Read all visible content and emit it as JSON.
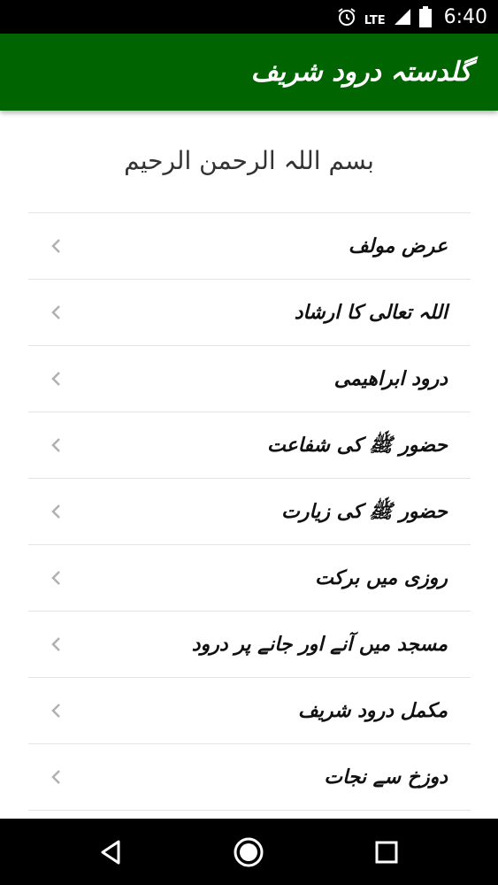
{
  "status_bar": {
    "network": "LTE",
    "time": "6:40",
    "icons": [
      "alarm-icon",
      "lte-signal-icon",
      "battery-icon"
    ]
  },
  "app_bar": {
    "title": "گلدستہ درود شریف",
    "color": "#006400"
  },
  "header": {
    "bismillah": "بسم اللہ الرحمن الرحیم"
  },
  "menu": {
    "items": [
      {
        "label": "عرض مولف"
      },
      {
        "label": "اللہ تعالی کا ارشاد"
      },
      {
        "label": "درود ابراھیمی"
      },
      {
        "label": "حضور ﷺ کی شفاعت"
      },
      {
        "label": "حضور ﷺ کی زیارت"
      },
      {
        "label": "روزی میں برکت"
      },
      {
        "label": "مسجد میں آنے اور جانے پر درود"
      },
      {
        "label": "مکمل درود شریف"
      },
      {
        "label": "دوزخ سے نجات"
      }
    ]
  },
  "nav_bar": {
    "icons": [
      "back-icon",
      "home-icon",
      "recents-icon"
    ]
  }
}
